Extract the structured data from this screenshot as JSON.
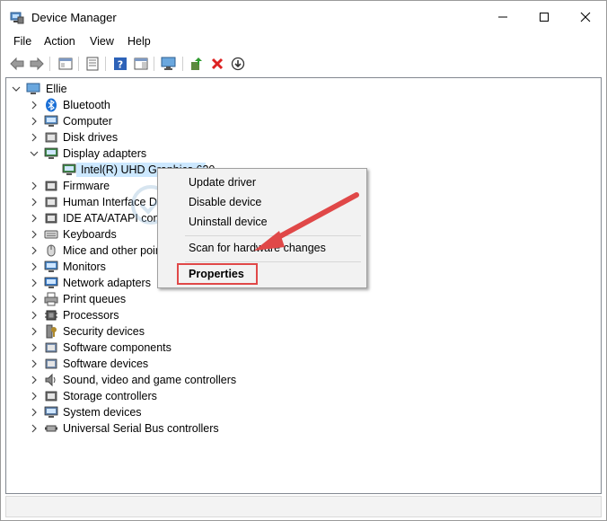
{
  "window": {
    "title": "Device Manager",
    "minimize_glyph": "—",
    "maximize_glyph": "☐",
    "close_glyph": "✕"
  },
  "menubar": [
    "File",
    "Action",
    "View",
    "Help"
  ],
  "toolbar": {
    "icons": [
      "back-arrow-icon",
      "forward-arrow-icon",
      "show-hide-console-tree-icon",
      "properties-icon",
      "help-icon",
      "action-pane-icon",
      "scan-hardware-monitor-icon",
      "update-driver-icon",
      "uninstall-device-icon",
      "enable-device-icon"
    ]
  },
  "tree": {
    "root": "Ellie",
    "items": [
      {
        "label": "Bluetooth",
        "icon": "bluetooth-icon",
        "expanded": false
      },
      {
        "label": "Computer",
        "icon": "computer-icon",
        "expanded": false
      },
      {
        "label": "Disk drives",
        "icon": "disk-drive-icon",
        "expanded": false
      },
      {
        "label": "Display adapters",
        "icon": "display-adapter-icon",
        "expanded": true
      },
      {
        "label": "Intel(R) UHD Graphics 630",
        "icon": "display-adapter-icon",
        "child": true,
        "selected": true
      },
      {
        "label": "Firmware",
        "icon": "firmware-icon",
        "expanded": false
      },
      {
        "label": "Human Interface De",
        "icon": "hid-icon",
        "expanded": false
      },
      {
        "label": "IDE ATA/ATAPI contr",
        "icon": "ide-controller-icon",
        "expanded": false
      },
      {
        "label": "Keyboards",
        "icon": "keyboard-icon",
        "expanded": false
      },
      {
        "label": "Mice and other poir",
        "icon": "mouse-icon",
        "expanded": false
      },
      {
        "label": "Monitors",
        "icon": "monitor-icon",
        "expanded": false
      },
      {
        "label": "Network adapters",
        "icon": "network-adapter-icon",
        "expanded": false
      },
      {
        "label": "Print queues",
        "icon": "printer-icon",
        "expanded": false
      },
      {
        "label": "Processors",
        "icon": "processor-icon",
        "expanded": false
      },
      {
        "label": "Security devices",
        "icon": "security-device-icon",
        "expanded": false
      },
      {
        "label": "Software components",
        "icon": "software-component-icon",
        "expanded": false
      },
      {
        "label": "Software devices",
        "icon": "software-device-icon",
        "expanded": false
      },
      {
        "label": "Sound, video and game controllers",
        "icon": "sound-icon",
        "expanded": false
      },
      {
        "label": "Storage controllers",
        "icon": "storage-controller-icon",
        "expanded": false
      },
      {
        "label": "System devices",
        "icon": "system-device-icon",
        "expanded": false
      },
      {
        "label": "Universal Serial Bus controllers",
        "icon": "usb-icon",
        "expanded": false
      }
    ]
  },
  "context_menu": {
    "items": [
      "Update driver",
      "Disable device",
      "Uninstall device",
      "Scan for hardware changes",
      "Properties"
    ],
    "highlighted": "Properties"
  },
  "watermark": {
    "text": "driver easy",
    "url": "www.DriverEasy.com"
  },
  "colors": {
    "highlight_red": "#e04848",
    "selection_blue": "#cce8ff",
    "arrow_red": "#e04848"
  }
}
